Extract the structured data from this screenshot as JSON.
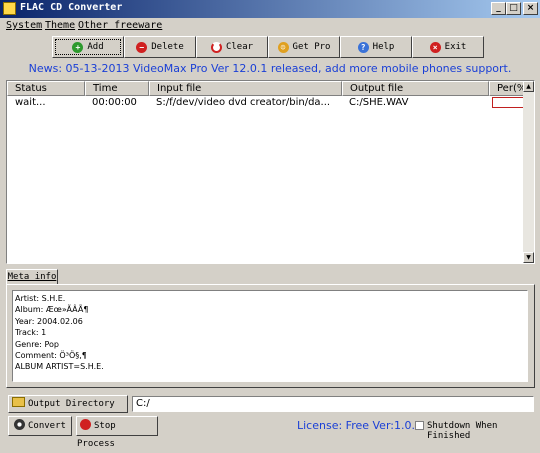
{
  "window": {
    "title": "FLAC CD Converter",
    "controls": {
      "minimize": "_",
      "maximize": "□",
      "close": "×"
    }
  },
  "menu": [
    "System",
    "Theme",
    "Other freeware"
  ],
  "toolbar": {
    "add": "Add",
    "delete": "Delete",
    "clear": "Clear",
    "get_pro": "Get Pro",
    "help": "Help",
    "exit": "Exit"
  },
  "news": "News: 05-13-2013 VideoMax Pro Ver 12.0.1 released, add more mobile phones support.",
  "table": {
    "columns": [
      "Status",
      "Time",
      "Input file",
      "Output file",
      "Per(%"
    ],
    "rows": [
      {
        "status": "wait...",
        "time": "00:00:00",
        "input": "S:/f/dev/video dvd creator/bin/da...",
        "output": "C:/SHE.WAV",
        "percent": 0
      }
    ]
  },
  "meta": {
    "tab_label": "Meta info",
    "lines": [
      "Artist:  S.H.E.",
      "Album:  Æœ»ÃÂÃ¶",
      "Year:   2004.02.06",
      "Track:  1",
      "Genre:  Pop",
      "Comment: Ö³Ö§,¶",
      "ALBUM ARTIST=S.H.E."
    ]
  },
  "output": {
    "button": "Output Directory ...",
    "value": "C:/"
  },
  "bottom": {
    "convert": "Convert",
    "stop": "Stop Process",
    "license": "License: Free Ver:1.0.1",
    "shutdown": "Shutdown When Finished",
    "shutdown_checked": false
  },
  "colors": {
    "accent_blue": "#1a3fd6",
    "title_start": "#0a246a",
    "title_end": "#a6caf0"
  }
}
